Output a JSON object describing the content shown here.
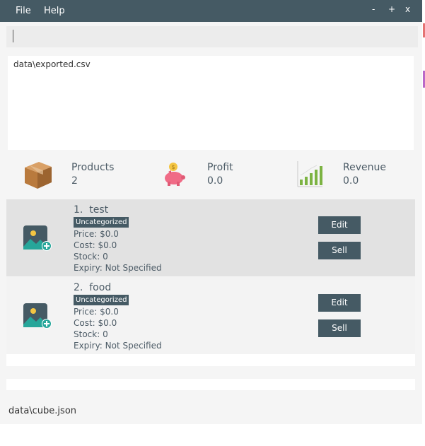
{
  "menu": {
    "file": "File",
    "help": "Help"
  },
  "window_controls": {
    "minimize": "-",
    "maximize": "+",
    "close": "x"
  },
  "command": {
    "value": ""
  },
  "result": {
    "text": "data\\exported.csv"
  },
  "stats": {
    "products": {
      "label": "Products",
      "value": "2",
      "icon": "box-icon"
    },
    "profit": {
      "label": "Profit",
      "value": "0.0",
      "icon": "piggy-bank-icon"
    },
    "revenue": {
      "label": "Revenue",
      "value": "0.0",
      "icon": "growth-chart-icon"
    }
  },
  "products": [
    {
      "title": "1.  test",
      "category": "Uncategorized",
      "price": "Price: $0.0",
      "cost": "Cost: $0.0",
      "stock": "Stock: 0",
      "expiry": "Expiry: Not Specified",
      "edit_label": "Edit",
      "sell_label": "Sell"
    },
    {
      "title": "2.  food",
      "category": "Uncategorized",
      "price": "Price: $0.0",
      "cost": "Cost: $0.0",
      "stock": "Stock: 0",
      "expiry": "Expiry: Not Specified",
      "edit_label": "Edit",
      "sell_label": "Sell"
    }
  ],
  "status_bar": {
    "path": "data\\cube.json"
  },
  "colors": {
    "titlebar": "#455a64",
    "accent_green": "#26a69a",
    "button": "#455a64"
  }
}
